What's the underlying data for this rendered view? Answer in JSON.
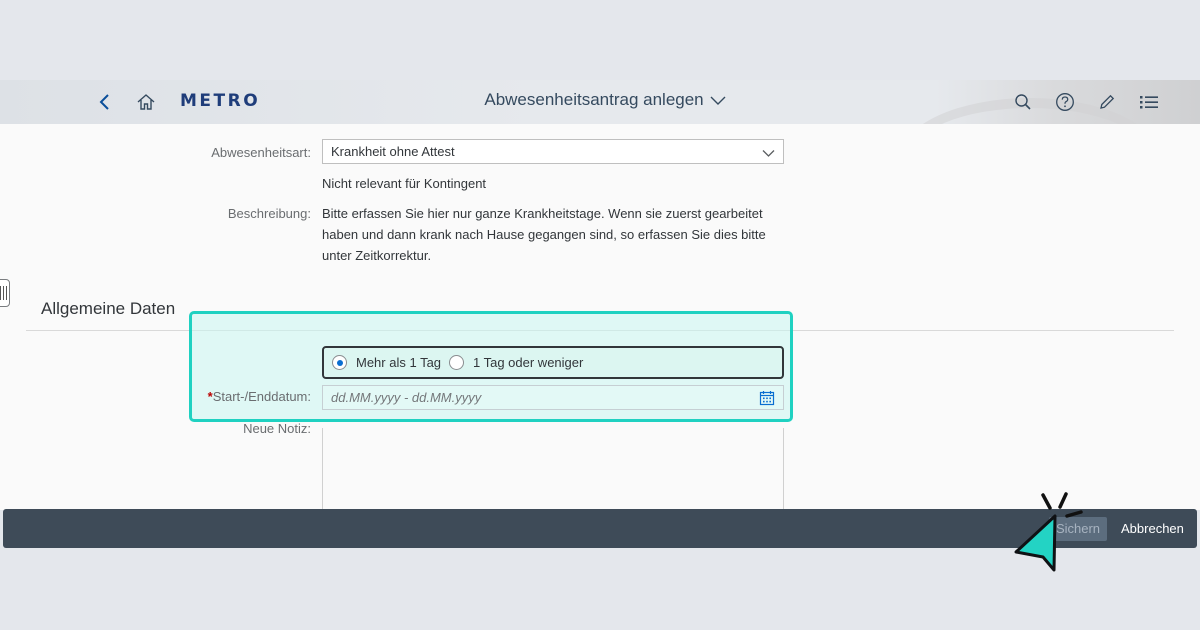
{
  "shell": {
    "logo": "METRO",
    "title": "Abwesenheitsantrag anlegen",
    "icons": [
      "back-icon",
      "home-icon",
      "search-icon",
      "help-icon",
      "edit-icon",
      "list-icon"
    ]
  },
  "form": {
    "absence_type_label": "Abwesenheitsart:",
    "absence_type_value": "Krankheit ohne Attest",
    "quota_note": "Nicht relevant für Kontingent",
    "description_label": "Beschreibung:",
    "description_text": "Bitte erfassen Sie hier nur ganze Krankheitstage. Wenn sie zuerst gearbeitet haben und dann krank nach Hause gegangen sind, so erfassen Sie dies bitte unter Zeitkorrektur."
  },
  "section": {
    "title": "Allgemeine Daten",
    "radio_options": [
      {
        "label": "Mehr als 1 Tag",
        "selected": true
      },
      {
        "label": "1 Tag oder weniger",
        "selected": false
      }
    ],
    "date_label_star": "*",
    "date_label": "Start-/Enddatum:",
    "date_placeholder": "dd.MM.yyyy - dd.MM.yyyy",
    "note_label": "Neue Notiz:"
  },
  "footer": {
    "save_label": "Sichern",
    "cancel_label": "Abbrechen"
  },
  "colors": {
    "highlight": "#1fd1c1",
    "footer": "#3e4b58",
    "radio_selected": "#0a6ed1",
    "logo": "#1f3d7a"
  }
}
